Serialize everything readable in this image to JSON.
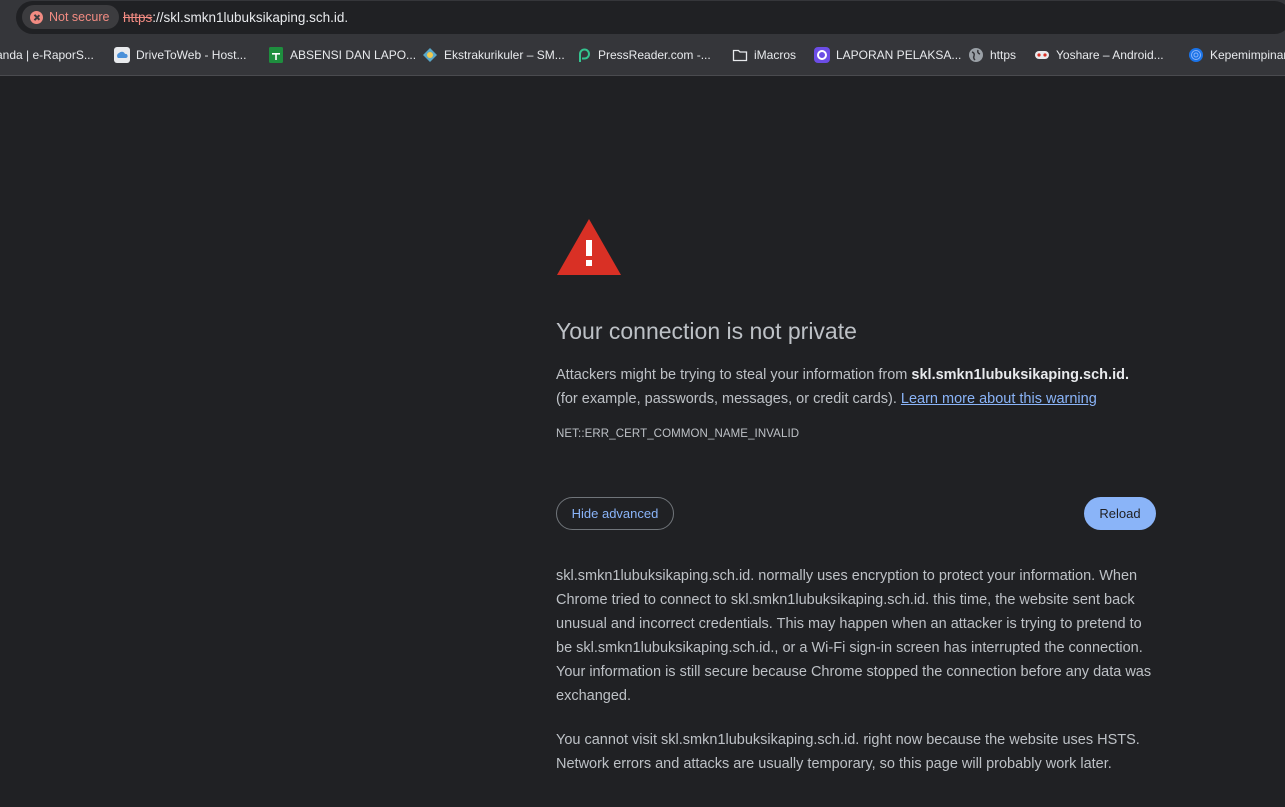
{
  "omnibox": {
    "security_label": "Not secure",
    "url_scheme": "https",
    "url_rest": "://skl.smkn1lubuksikaping.sch.id."
  },
  "bookmarks": [
    {
      "label": "anda | e-RaporS...",
      "icon": "page-icon"
    },
    {
      "label": "DriveToWeb - Host...",
      "icon": "cloud-icon"
    },
    {
      "label": "ABSENSI DAN LAPO...",
      "icon": "sheets-icon"
    },
    {
      "label": "Ekstrakurikuler – SM...",
      "icon": "school-logo-icon"
    },
    {
      "label": "PressReader.com -...",
      "icon": "pressreader-icon"
    },
    {
      "label": "iMacros",
      "icon": "folder-icon"
    },
    {
      "label": "LAPORAN PELAKSA...",
      "icon": "app-icon"
    },
    {
      "label": "https",
      "icon": "globe-icon"
    },
    {
      "label": "Yoshare – Android...",
      "icon": "gamepad-icon"
    },
    {
      "label": "Kepemimpinan",
      "icon": "fingerprint-icon"
    }
  ],
  "interstitial": {
    "title": "Your connection is not private",
    "p1_before": "Attackers might be trying to steal your information from ",
    "p1_host": "skl.smkn1lubuksikaping.sch.id.",
    "p1_after": " (for example, passwords, messages, or credit cards). ",
    "learn_more": "Learn more about this warning",
    "error_code": "NET::ERR_CERT_COMMON_NAME_INVALID",
    "hide_advanced": "Hide advanced",
    "reload": "Reload",
    "details_p1": "skl.smkn1lubuksikaping.sch.id. normally uses encryption to protect your information. When Chrome tried to connect to skl.smkn1lubuksikaping.sch.id. this time, the website sent back unusual and incorrect credentials. This may happen when an attacker is trying to pretend to be skl.smkn1lubuksikaping.sch.id., or a Wi-Fi sign-in screen has interrupted the connection. Your information is still secure because Chrome stopped the connection before any data was exchanged.",
    "details_p2": "You cannot visit skl.smkn1lubuksikaping.sch.id. right now because the website uses HSTS. Network errors and attacks are usually temporary, so this page will probably work later."
  },
  "colors": {
    "background": "#202124",
    "text": "#bdc1c6",
    "link": "#8ab4f8",
    "warning_red": "#d93025",
    "not_secure": "#f28b82"
  }
}
